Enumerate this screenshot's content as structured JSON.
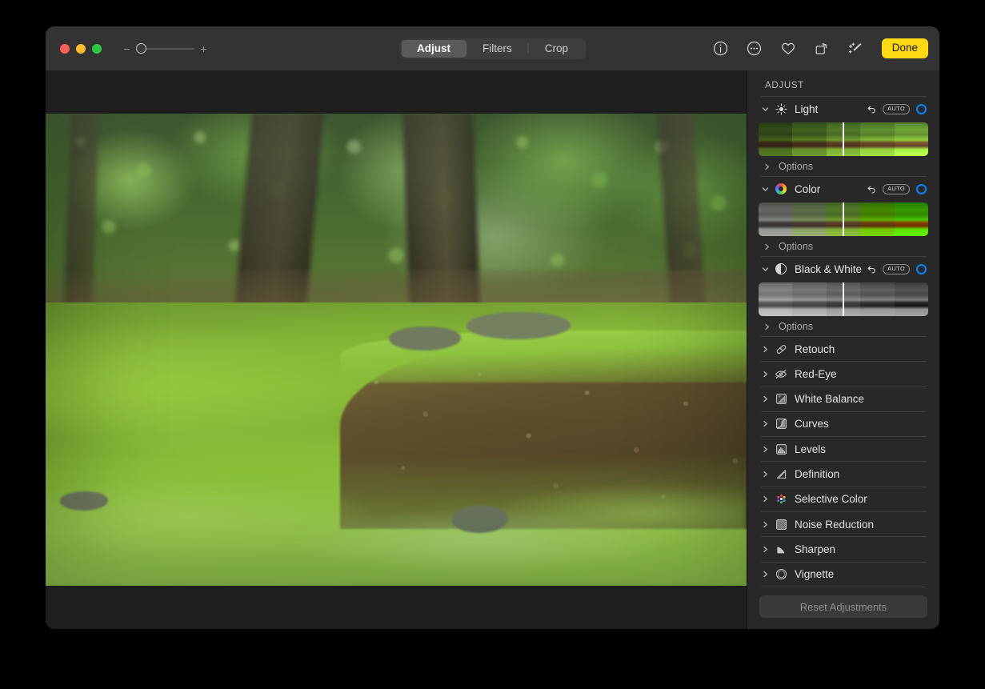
{
  "window": {
    "traffic_lights": [
      "close",
      "minimize",
      "maximize"
    ],
    "colors": {
      "close": "#ff5f57",
      "minimize": "#febc2e",
      "maximize": "#28c840"
    }
  },
  "toolbar": {
    "zoom": {
      "minus": "−",
      "plus": "+",
      "value_percent": 0
    },
    "segments": [
      {
        "label": "Adjust",
        "active": true
      },
      {
        "label": "Filters",
        "active": false
      },
      {
        "label": "Crop",
        "active": false
      }
    ],
    "icons": [
      {
        "name": "info-icon",
        "glyph": "i"
      },
      {
        "name": "more-options-icon",
        "glyph": "…"
      },
      {
        "name": "favorite-heart-icon",
        "glyph": "♡"
      },
      {
        "name": "rotate-icon",
        "glyph": "↻"
      },
      {
        "name": "auto-enhance-wand-icon",
        "glyph": "✦"
      }
    ],
    "done_label": "Done",
    "done_color": "#fcd913"
  },
  "sidebar": {
    "title": "ADJUST",
    "accent_color": "#0a84ff",
    "auto_label": "AUTO",
    "options_label": "Options",
    "expanded_sections": [
      {
        "id": "light",
        "label": "Light",
        "icon": "brightness-sun-icon",
        "expanded": true,
        "has_auto": true,
        "has_revert": true,
        "enabled": true,
        "filmstrip": {
          "frames": 5,
          "playhead_position": 0.5,
          "style": "exposure"
        }
      },
      {
        "id": "color",
        "label": "Color",
        "icon": "color-wheel-icon",
        "expanded": true,
        "has_auto": true,
        "has_revert": true,
        "enabled": true,
        "filmstrip": {
          "frames": 5,
          "playhead_position": 0.5,
          "style": "saturation"
        }
      },
      {
        "id": "black-and-white",
        "label": "Black & White",
        "icon": "black-white-circle-icon",
        "expanded": true,
        "has_auto": true,
        "has_revert": true,
        "enabled": true,
        "filmstrip": {
          "frames": 5,
          "playhead_position": 0.5,
          "style": "grayscale"
        }
      }
    ],
    "collapsed_sections": [
      {
        "id": "retouch",
        "label": "Retouch",
        "icon": "bandage-retouch-icon"
      },
      {
        "id": "red-eye",
        "label": "Red-Eye",
        "icon": "eye-slash-icon"
      },
      {
        "id": "white-balance",
        "label": "White Balance",
        "icon": "white-balance-icon"
      },
      {
        "id": "curves",
        "label": "Curves",
        "icon": "curves-icon"
      },
      {
        "id": "levels",
        "label": "Levels",
        "icon": "levels-histogram-icon"
      },
      {
        "id": "definition",
        "label": "Definition",
        "icon": "definition-triangle-icon"
      },
      {
        "id": "selective-color",
        "label": "Selective Color",
        "icon": "selective-color-dots-icon"
      },
      {
        "id": "noise-reduction",
        "label": "Noise Reduction",
        "icon": "noise-grain-icon"
      },
      {
        "id": "sharpen",
        "label": "Sharpen",
        "icon": "sharpen-triangle-icon"
      },
      {
        "id": "vignette",
        "label": "Vignette",
        "icon": "vignette-circle-icon"
      }
    ],
    "reset_label": "Reset Adjustments",
    "reset_enabled": false
  },
  "photo": {
    "subject": "mossy forest floor with tree roots and earth embankment",
    "letterbox": true
  }
}
